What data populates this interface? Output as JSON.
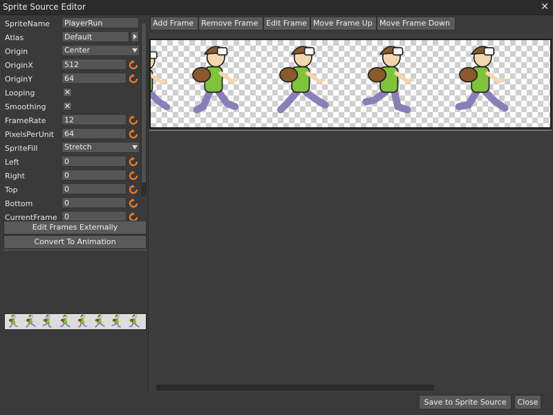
{
  "window": {
    "title": "Sprite Source Editor",
    "close_glyph": "✕"
  },
  "properties": [
    {
      "label": "SpriteName",
      "value": "PlayerRun",
      "kind": "text"
    },
    {
      "label": "Atlas",
      "value": "Default",
      "kind": "text-play"
    },
    {
      "label": "Origin",
      "value": "Center",
      "kind": "select"
    },
    {
      "label": "OriginX",
      "value": "512",
      "kind": "number-reset"
    },
    {
      "label": "OriginY",
      "value": "64",
      "kind": "number-reset"
    },
    {
      "label": "Looping",
      "value": "✕",
      "kind": "checkbox"
    },
    {
      "label": "Smoothing",
      "value": "✕",
      "kind": "checkbox"
    },
    {
      "label": "FrameRate",
      "value": "12",
      "kind": "number-reset"
    },
    {
      "label": "PixelsPerUnit",
      "value": "64",
      "kind": "number-reset"
    },
    {
      "label": "SpriteFill",
      "value": "Stretch",
      "kind": "select"
    },
    {
      "label": "Left",
      "value": "0",
      "kind": "number-reset"
    },
    {
      "label": "Right",
      "value": "0",
      "kind": "number-reset"
    },
    {
      "label": "Top",
      "value": "0",
      "kind": "number-reset"
    },
    {
      "label": "Bottom",
      "value": "0",
      "kind": "number-reset"
    },
    {
      "label": "CurrentFrame",
      "value": "0",
      "kind": "number-reset"
    }
  ],
  "left_buttons": {
    "edit_externally": "Edit Frames Externally",
    "convert": "Convert To Animation"
  },
  "toolbar": {
    "add": "Add Frame",
    "remove": "Remove Frame",
    "edit": "Edit Frame",
    "move_up": "Move Frame Up",
    "move_down": "Move Frame Down"
  },
  "footer": {
    "save": "Save to Sprite Source",
    "close": "Close"
  },
  "colors": {
    "background": "#3a3a3a",
    "reset_icon": "#e8782a",
    "skin": "#f3d6b0",
    "shirt": "#7fc23b",
    "pants": "#8b7fb8",
    "helmet": "#8a5a2e"
  }
}
